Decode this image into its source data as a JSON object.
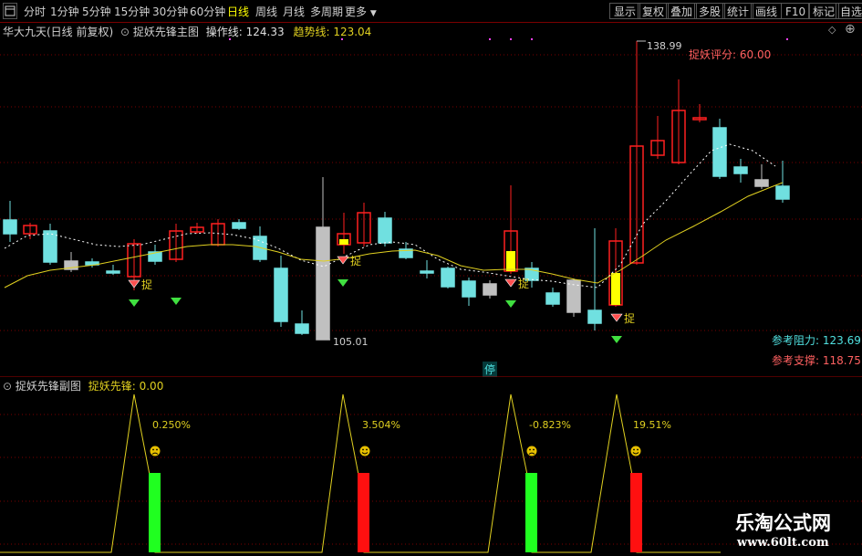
{
  "toolbar": {
    "periods": [
      "分时",
      "1分钟",
      "5分钟",
      "15分钟",
      "30分钟",
      "60分钟",
      "日线",
      "周线",
      "月线",
      "多周期",
      "更多"
    ],
    "active_period": "日线",
    "right_buttons": [
      "显示",
      "复权",
      "叠加",
      "多股",
      "统计",
      "画线",
      "F10",
      "标记",
      "自选"
    ]
  },
  "main_header": {
    "stock": "华大九天(日线 前复权)",
    "indicator": "捉妖先锋主图",
    "op_label": "操作线:",
    "op_value": "124.33",
    "trend_label": "趋势线:",
    "trend_value": "123.04"
  },
  "main_chart": {
    "high_label": "138.99",
    "low_label": "105.01",
    "score_label": "捉妖评分:",
    "score_value": "60.00",
    "resistance_label": "参考阻力:",
    "resistance_value": "123.69",
    "support_label": "参考支撑:",
    "support_value": "118.75",
    "stop_label": "停",
    "signal_char": "捉",
    "colors": {
      "up": "#ff2020",
      "down": "#70e0e0",
      "ma": "#ffffff",
      "trend": "#e0d020",
      "grid": "#7a0000"
    }
  },
  "sub_header": {
    "indicator": "捉妖先锋副图",
    "label": "捉妖先锋:",
    "value": "0.00"
  },
  "sub_chart": {
    "annotations": [
      "0.250%",
      "3.504%",
      "-0.823%",
      "19.51%"
    ],
    "bar_colors": [
      "#20ff20",
      "#ff1010",
      "#20ff20",
      "#ff1010"
    ]
  },
  "watermark": {
    "title": "乐淘公式网",
    "url": "www.60lt.com"
  }
}
